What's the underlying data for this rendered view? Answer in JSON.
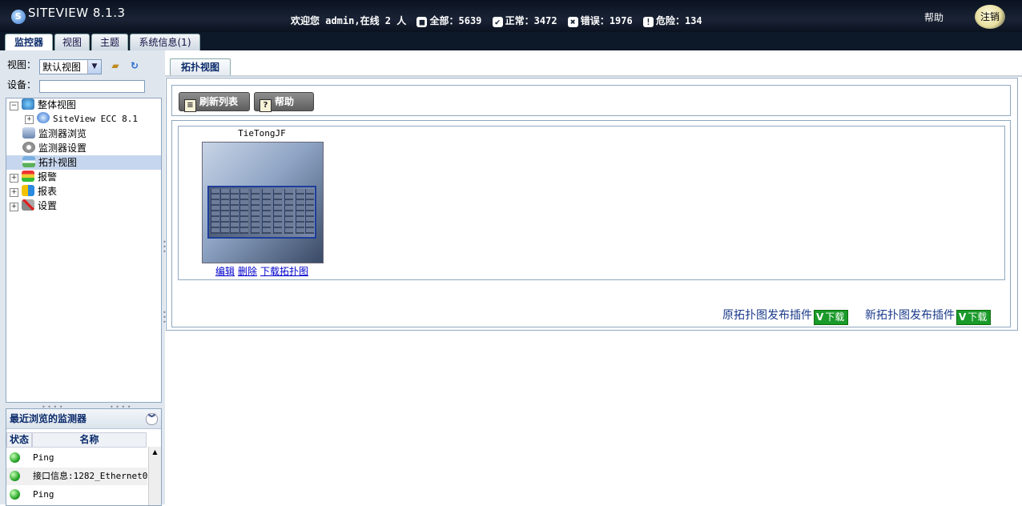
{
  "header": {
    "logo_text": "SITEVIEW 8.1.3",
    "welcome": "欢迎您 admin,在线 2 人",
    "counts": [
      {
        "label": "全部：",
        "value": "5639",
        "icon": "total-icon"
      },
      {
        "label": "正常：",
        "value": "3472",
        "icon": "check-icon"
      },
      {
        "label": "错误：",
        "value": "1976",
        "icon": "error-x-icon"
      },
      {
        "label": "危险：",
        "value": "134",
        "icon": "warning-icon"
      }
    ],
    "help": "帮助",
    "logout": "注销"
  },
  "tabs": [
    "监控器",
    "视图",
    "主题",
    "系统信息(1)"
  ],
  "left": {
    "view_label": "视图：",
    "view_selected": "默认视图",
    "device_label": "设备：",
    "device_value": "",
    "tree": [
      {
        "label": "整体视图",
        "icon": "globe-network-icon"
      },
      {
        "label": "SiteView ECC 8.1",
        "icon": "siteview-logo-icon"
      },
      {
        "label": "监测器浏览",
        "icon": "monitor-computer-icon"
      },
      {
        "label": "监测器设置",
        "icon": "settings-gear-icon"
      },
      {
        "label": "拓扑视图",
        "icon": "topology-icon"
      },
      {
        "label": "报警",
        "icon": "traffic-light-icon"
      },
      {
        "label": "报表",
        "icon": "report-icon"
      },
      {
        "label": "设置",
        "icon": "tools-icon"
      }
    ],
    "recent": {
      "title": "最近浏览的监测器",
      "col_status": "状态",
      "col_name": "名称",
      "rows": [
        "Ping",
        "接口信息:1282_Ethernet0,",
        "Ping"
      ]
    }
  },
  "content": {
    "tab": "拓扑视图",
    "refresh_button": "刷新列表",
    "help_button": "帮助",
    "topology_name": "TieTongJF",
    "links": [
      "编辑",
      "删除",
      "下载拓扑图"
    ],
    "plugins": [
      {
        "label": "原拓扑图发布插件",
        "badge": "下载"
      },
      {
        "label": "新拓扑图发布插件",
        "badge": "下载"
      }
    ]
  }
}
